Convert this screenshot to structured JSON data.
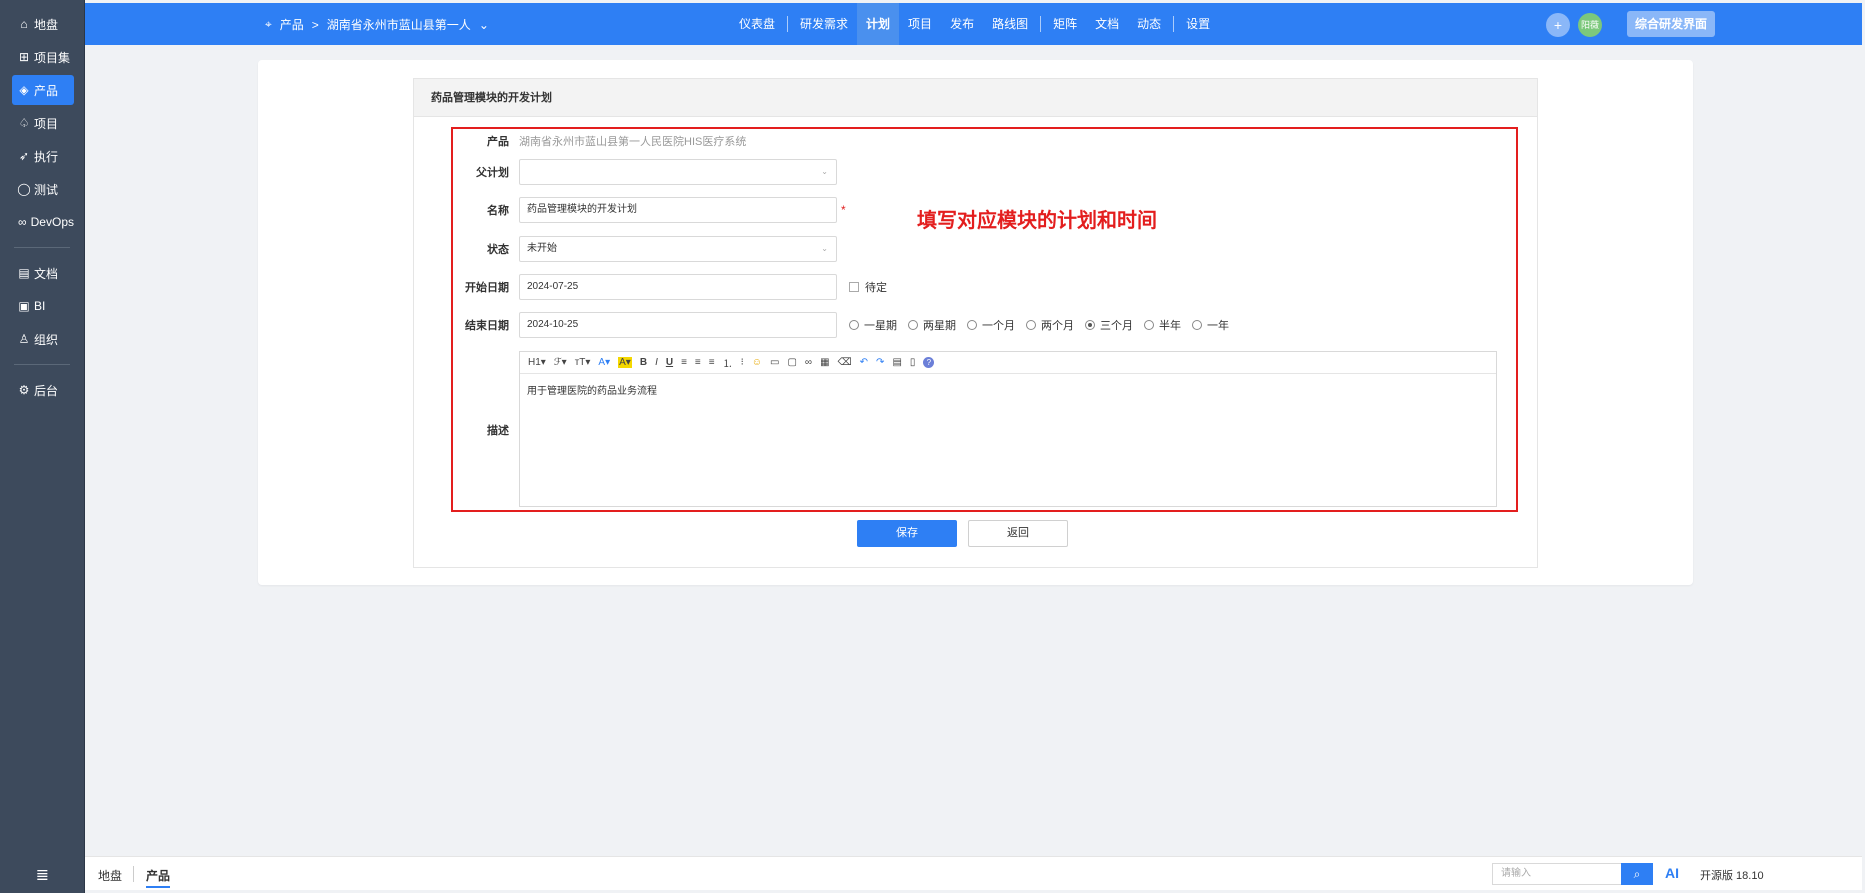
{
  "sidebar": {
    "items": [
      {
        "icon": "home-icon",
        "glyph": "⌂",
        "label": "地盘"
      },
      {
        "icon": "grid-icon",
        "glyph": "⊞",
        "label": "项目集"
      },
      {
        "icon": "lightbulb-icon",
        "glyph": "◈",
        "label": "产品"
      },
      {
        "icon": "bell-icon",
        "glyph": "♤",
        "label": "项目"
      },
      {
        "icon": "run-icon",
        "glyph": "➶",
        "label": "执行"
      },
      {
        "icon": "search-icon",
        "glyph": "◯",
        "label": "测试"
      },
      {
        "icon": "infinity-icon",
        "glyph": "∞",
        "label": "DevOps"
      },
      {
        "icon": "document-icon",
        "glyph": "▤",
        "label": "文档"
      },
      {
        "icon": "chart-icon",
        "glyph": "▣",
        "label": "BI"
      },
      {
        "icon": "people-icon",
        "glyph": "♙",
        "label": "组织"
      },
      {
        "icon": "settings-icon",
        "glyph": "⚙",
        "label": "后台"
      }
    ],
    "active_index": 2,
    "collapse_glyph": "≣"
  },
  "topbar": {
    "breadcrumb": {
      "product_label": "产品",
      "separator": ">",
      "product_name": "湖南省永州市蓝山县第一人",
      "caret": "⌄"
    },
    "nav": [
      "仪表盘",
      "研发需求",
      "计划",
      "项目",
      "发布",
      "路线图",
      "矩阵",
      "文档",
      "动态",
      "设置"
    ],
    "active_nav": "计划",
    "plus": "+",
    "avatar_text": "阳薇",
    "workspace_button": "综合研发界面"
  },
  "form": {
    "title": "药品管理模块的开发计划",
    "product_label": "产品",
    "product_value": "湖南省永州市蓝山县第一人民医院HIS医疗系统",
    "parent_label": "父计划",
    "parent_value": "",
    "name_label": "名称",
    "name_value": "药品管理模块的开发计划",
    "required_mark": "*",
    "status_label": "状态",
    "status_value": "未开始",
    "start_label": "开始日期",
    "start_value": "2024-07-25",
    "pending_label": "待定",
    "end_label": "结束日期",
    "end_value": "2024-10-25",
    "durations": [
      "一星期",
      "两星期",
      "一个月",
      "两个月",
      "三个月",
      "半年",
      "一年"
    ],
    "selected_duration": "三个月",
    "desc_label": "描述",
    "desc_value": "用于管理医院的药品业务流程",
    "save_label": "保存",
    "back_label": "返回"
  },
  "editor_toolbar": [
    {
      "name": "heading-icon",
      "glyph": "H1▾"
    },
    {
      "name": "font-family-icon",
      "glyph": "ℱ▾"
    },
    {
      "name": "font-size-icon",
      "glyph": "тT▾"
    },
    {
      "name": "font-color-icon",
      "glyph": "A▾"
    },
    {
      "name": "highlight-icon",
      "glyph": "A▾"
    },
    {
      "name": "bold-icon",
      "glyph": "B"
    },
    {
      "name": "italic-icon",
      "glyph": "I"
    },
    {
      "name": "underline-icon",
      "glyph": "U"
    },
    {
      "name": "align-left-icon",
      "glyph": "≡"
    },
    {
      "name": "align-center-icon",
      "glyph": "≡"
    },
    {
      "name": "align-right-icon",
      "glyph": "≡"
    },
    {
      "name": "ordered-list-icon",
      "glyph": "⒈"
    },
    {
      "name": "bullet-list-icon",
      "glyph": "⁝"
    },
    {
      "name": "emoji-icon",
      "glyph": "☺"
    },
    {
      "name": "image-icon",
      "glyph": "▭"
    },
    {
      "name": "code-icon",
      "glyph": "▢"
    },
    {
      "name": "link-icon",
      "glyph": "∞"
    },
    {
      "name": "table-icon",
      "glyph": "▦"
    },
    {
      "name": "eraser-icon",
      "glyph": "⌫"
    },
    {
      "name": "undo-icon",
      "glyph": "↶"
    },
    {
      "name": "redo-icon",
      "glyph": "↷"
    },
    {
      "name": "template-icon",
      "glyph": "▤"
    },
    {
      "name": "paste-icon",
      "glyph": "▯"
    },
    {
      "name": "help-icon",
      "glyph": "?"
    }
  ],
  "annotation": "填写对应模块的计划和时间",
  "bottombar": {
    "tabs": [
      "地盘",
      "产品"
    ],
    "active_tab": "产品",
    "search_placeholder": "请输入",
    "search_icon": "⌕",
    "ai_label": "AI",
    "version_text": "开源版 18.10"
  },
  "colors": {
    "accent": "#2e7ff4",
    "sidebar": "#3d4a5c",
    "annotation": "#e31e1e"
  }
}
